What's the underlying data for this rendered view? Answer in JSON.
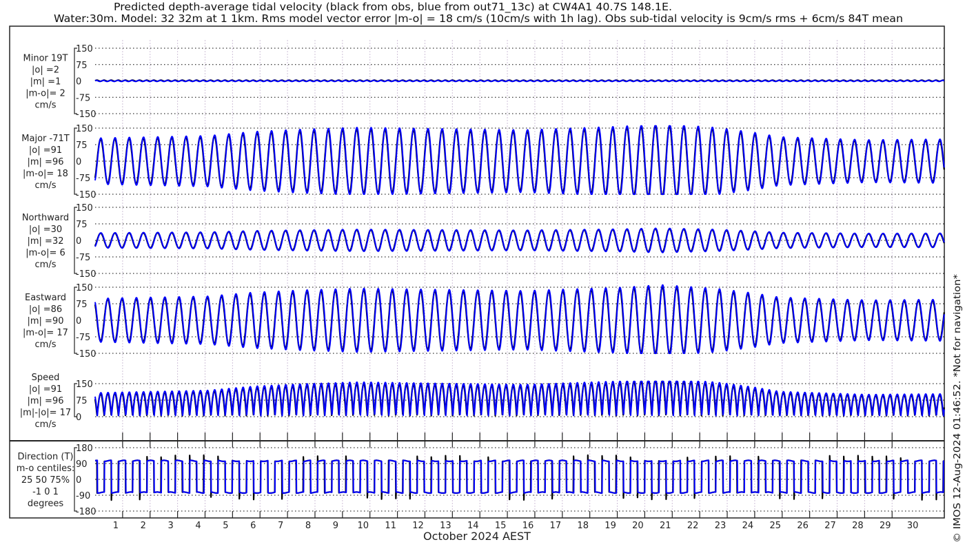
{
  "title": {
    "line1": "Predicted depth-average tidal velocity (black from obs, blue from out71_13c) at CW4A1 40.7S 148.1E.",
    "line2": "Water:30m. Model: 32 32m at 1 1km. Rms model vector error |m-o| = 18 cm/s (10cm/s with 1h lag). Obs sub-tidal velocity is 9cm/s rms + 6cm/s 84T mean"
  },
  "side_note": "© IMOS 12-Aug-2024 01:46:52. *Not for navigation*",
  "chart_data": {
    "type": "line",
    "xlabel": "October 2024 AEST",
    "x_unit": "day of October",
    "xlim": [
      1.0,
      31.9
    ],
    "x_ticks": [
      2,
      3,
      4,
      5,
      6,
      7,
      8,
      9,
      10,
      11,
      12,
      13,
      14,
      15,
      16,
      17,
      18,
      19,
      20,
      21,
      22,
      23,
      24,
      25,
      26,
      27,
      28,
      29,
      30
    ],
    "x_tick_labels": [
      "1",
      "2",
      "3",
      "4",
      "5",
      "6",
      "7",
      "8",
      "9",
      "10",
      "11",
      "12",
      "13",
      "14",
      "15",
      "16",
      "17",
      "18",
      "19",
      "20",
      "21",
      "22",
      "23",
      "24",
      "25",
      "26",
      "27",
      "28",
      "29",
      "30"
    ],
    "legend": [
      {
        "name": "obs",
        "color": "#000000"
      },
      {
        "name": "model (out71_13c)",
        "color": "#0000ff"
      }
    ],
    "tide": {
      "period_hours": 12.42,
      "first_major_peak_day": 1.2,
      "major_axis_deg_true": -71,
      "envelope_days": [
        1.0,
        1.2,
        5.1,
        6.8,
        8.6,
        10.6,
        12.6,
        16.6,
        20.1,
        21.6,
        23.6,
        24.9,
        25.9,
        27.6,
        29.1,
        31.9
      ],
      "envelope_obs_cm_s": [
        100,
        100,
        110,
        128,
        138,
        146,
        142,
        135,
        150,
        162,
        145,
        125,
        105,
        98,
        92,
        95
      ],
      "model_scale": 1.05,
      "model_lag_days": 0.01
    },
    "panels": [
      {
        "id": "minor",
        "labels": [
          "Minor 19T",
          "|o| =2",
          "|m| =1",
          "|m-o|= 2",
          "cm/s"
        ],
        "ylim": [
          -150,
          150
        ],
        "yticks": [
          150,
          75,
          0,
          -75,
          -150
        ],
        "ytick_labels": [
          "150",
          "75",
          "0",
          "-75",
          "-150"
        ]
      },
      {
        "id": "major",
        "labels": [
          "Major -71T",
          "|o| =91",
          "|m| =96",
          "|m-o|= 18",
          "cm/s"
        ],
        "ylim": [
          -150,
          150
        ],
        "yticks": [
          150,
          75,
          0,
          -75,
          -150
        ],
        "ytick_labels": [
          "150",
          "75",
          "0",
          "-75",
          "-150"
        ]
      },
      {
        "id": "north",
        "labels": [
          "Northward",
          "|o| =30",
          "|m| =32",
          "|m-o|= 6",
          "cm/s"
        ],
        "ylim": [
          -150,
          150
        ],
        "yticks": [
          150,
          75,
          0,
          -75,
          -150
        ],
        "ytick_labels": [
          "150",
          "75",
          "0",
          "-75",
          "-150"
        ]
      },
      {
        "id": "east",
        "labels": [
          "Eastward",
          "|o| =86",
          "|m| =90",
          "|m-o|= 17",
          "cm/s"
        ],
        "ylim": [
          -150,
          150
        ],
        "yticks": [
          150,
          75,
          0,
          -75,
          -150
        ],
        "ytick_labels": [
          "150",
          "75",
          "0",
          "-75",
          "-150"
        ]
      },
      {
        "id": "speed",
        "labels": [
          "Speed",
          "|o| =91",
          "|m| =96",
          "|m|-|o|= 17",
          "cm/s"
        ],
        "ylim": [
          0,
          150
        ],
        "yticks": [
          150,
          75,
          0
        ],
        "ytick_labels": [
          "150",
          "75",
          "0"
        ]
      },
      {
        "id": "direction",
        "labels": [
          "Direction (T)",
          "m-o centiles:",
          "25  50  75%",
          "-1  0  1",
          "degrees"
        ],
        "ylim": [
          -180,
          180
        ],
        "yticks": [
          180,
          90,
          0,
          -90,
          -180
        ],
        "ytick_labels": [
          "180",
          "90",
          "0",
          "-90",
          "-180"
        ],
        "flood_dir": 105,
        "ebb_dir": -75
      }
    ]
  }
}
